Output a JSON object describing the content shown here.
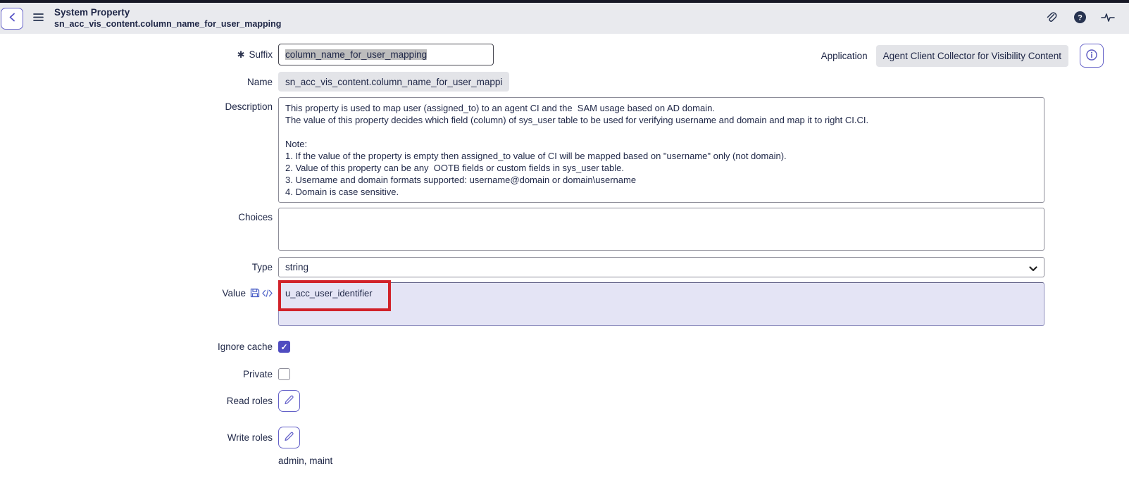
{
  "header": {
    "title": "System Property",
    "subtitle": "sn_acc_vis_content.column_name_for_user_mapping",
    "icons": {
      "back": "chevron-left",
      "menu": "hamburger",
      "attachment": "paperclip",
      "help": "question-circle",
      "activity": "pulse"
    }
  },
  "form": {
    "suffix": {
      "label": "Suffix",
      "required_marker": "✱",
      "value": "column_name_for_user_mapping",
      "selected": true
    },
    "application": {
      "label": "Application",
      "value": "Agent Client Collector for Visibility Content"
    },
    "name": {
      "label": "Name",
      "value": "sn_acc_vis_content.column_name_for_user_mappi"
    },
    "description": {
      "label": "Description",
      "value": "This property is used to map user (assigned_to) to an agent CI and the  SAM usage based on AD domain.\nThe value of this property decides which field (column) of sys_user table to be used for verifying username and domain and map it to right CI.CI.\n\nNote:\n1. If the value of the property is empty then assigned_to value of CI will be mapped based on \"username\" only (not domain).\n2. Value of this property can be any  OOTB fields or custom fields in sys_user table.\n3. Username and domain formats supported: username@domain or domain\\username\n4. Domain is case sensitive."
    },
    "choices": {
      "label": "Choices",
      "value": ""
    },
    "type": {
      "label": "Type",
      "value": "string"
    },
    "value_field": {
      "label": "Value",
      "value": "u_acc_user_identifier",
      "annotation": "red-highlight-box"
    },
    "ignore_cache": {
      "label": "Ignore cache",
      "checked": true
    },
    "private": {
      "label": "Private",
      "checked": false
    },
    "read_roles": {
      "label": "Read roles"
    },
    "write_roles": {
      "label": "Write roles",
      "roles_text": "admin, maint"
    }
  },
  "colors": {
    "accent_purple": "#5e5cc7",
    "checkbox_checked": "#4f4cc0",
    "header_bg": "#e9eaee",
    "top_strip": "#171826",
    "text_navy": "#1f2747",
    "readonly_bg": "#e3e4e8",
    "value_field_bg": "#e4e4f5",
    "annotation_red": "#d1222a"
  }
}
